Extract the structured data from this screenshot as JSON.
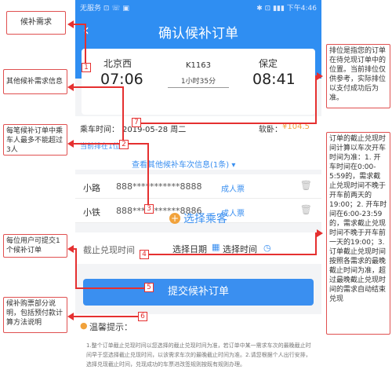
{
  "status_bar": {
    "left": "无服务 ⊡ ☏ ▣",
    "right": "✱ ⊡ ▮▮▮ 下午4:46"
  },
  "header": {
    "back_icon": "chevron-left-icon",
    "title": "确认候补订单"
  },
  "trip": {
    "from_station": "北京西",
    "depart_time": "07:06",
    "train_no": "K1163",
    "duration": "1小时35分",
    "to_station": "保定",
    "arrive_time": "08:41"
  },
  "info": {
    "date_label": "乘车时间：",
    "date_value": "2019-05-28 周二",
    "seat_label": "软卧：",
    "seat_price": "¥104.5",
    "queue_text": "当前排在1位",
    "other_trains_link": "查看其他候补车次信息(1条) ▾"
  },
  "passengers": [
    {
      "name": "小路",
      "id": "888***********8888",
      "type": "成人票"
    },
    {
      "name": "小铁",
      "id": "888***********8886",
      "type": "成人票"
    }
  ],
  "add_passenger": {
    "icon": "plus-icon",
    "label": "选择乘客"
  },
  "deadline": {
    "label": "截止兑现时间",
    "date_option": "选择日期",
    "time_option": "选择时间",
    "calendar_icon": "calendar-icon",
    "clock_icon": "clock-icon"
  },
  "submit_label": "提交候补订单",
  "tips": {
    "title": "温馨提示：",
    "text": "1.整个订单截止兑现时间以您选择的截止兑现时间为准，若订单中某一需求车次的最晚截止时间早于您选择截止兑现时间，以该需求车次的最晚截止时间为准。2.请您根据个人出行安排，选择兑现截止时间，兑现成功的车票进改签规则按既有规则办理。"
  },
  "callouts": {
    "c1": "候补需求",
    "c2": "其他候补需求信息",
    "c3": "每笔候补订单中乘车人最多不能超过3人",
    "c4": "每位用户可提交1个候补订单",
    "c5": "候补购票部分说明，包括预付款计算方法说明",
    "c6": "排位是指您的订单在待兑现订单中的位置。当前排位仅供参考，实际排位以支付成功后为准。",
    "c7": "订单的截止兑现时间计算以车次开车时间为准：1. 开车时间在0:00-5:59的，需求截止兑现时间不晚于开车前两天的19:00；2. 开车时间在6:00-23:59的，需求截止兑现时间不晚于开车前一天的19:00；3. 订单截止兑现时间按照各需求的最晚截止时间为准，超过最晚截止兑现时间的需求自动结束兑现"
  },
  "markers": [
    "1",
    "2",
    "3",
    "4",
    "5",
    "6",
    "7"
  ]
}
